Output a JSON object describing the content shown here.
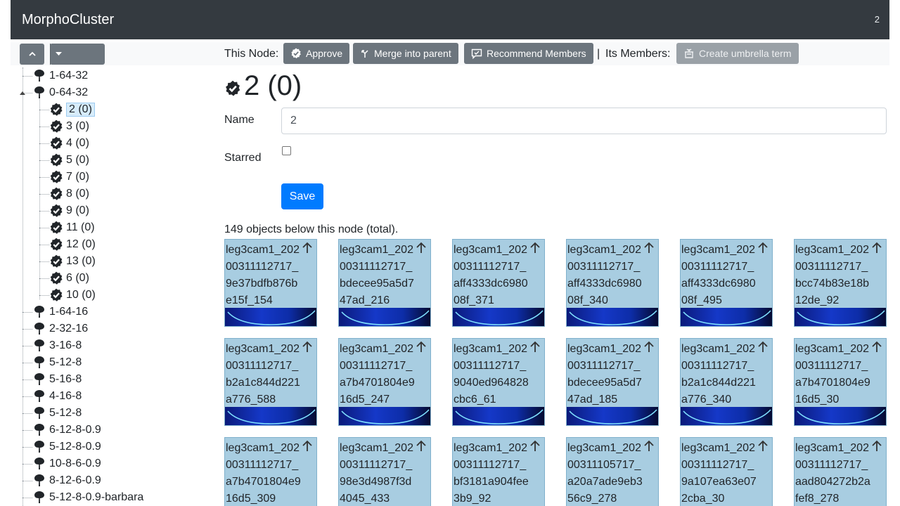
{
  "navbar": {
    "brand": "MorphoCluster",
    "right_text": "2"
  },
  "toolbar": {
    "this_node_label": "This Node:",
    "approve_label": "Approve",
    "merge_label": "Merge into parent",
    "recommend_label": "Recommend Members",
    "separator": "|",
    "its_members_label": "Its Members:",
    "umbrella_label": "Create umbrella term"
  },
  "tree": {
    "items": [
      {
        "label": "1-64-32",
        "icon": "tree-icon",
        "level": 0
      },
      {
        "label": "0-64-32",
        "icon": "tree-icon",
        "level": 0,
        "expanded": true
      },
      {
        "label": "2 (0)",
        "icon": "approved-badge-icon",
        "level": 1,
        "selected": true
      },
      {
        "label": "3 (0)",
        "icon": "approved-badge-icon",
        "level": 1
      },
      {
        "label": "4 (0)",
        "icon": "approved-badge-icon",
        "level": 1
      },
      {
        "label": "5 (0)",
        "icon": "approved-badge-icon",
        "level": 1
      },
      {
        "label": "7 (0)",
        "icon": "approved-badge-icon",
        "level": 1
      },
      {
        "label": "8 (0)",
        "icon": "approved-badge-icon",
        "level": 1
      },
      {
        "label": "9 (0)",
        "icon": "approved-badge-icon",
        "level": 1
      },
      {
        "label": "11 (0)",
        "icon": "approved-badge-icon",
        "level": 1
      },
      {
        "label": "12 (0)",
        "icon": "approved-badge-icon",
        "level": 1
      },
      {
        "label": "13 (0)",
        "icon": "approved-badge-icon",
        "level": 1
      },
      {
        "label": "6 (0)",
        "icon": "approved-badge-icon",
        "level": 1
      },
      {
        "label": "10 (0)",
        "icon": "approved-badge-icon",
        "level": 1
      },
      {
        "label": "1-64-16",
        "icon": "tree-icon",
        "level": 0
      },
      {
        "label": "2-32-16",
        "icon": "tree-icon",
        "level": 0
      },
      {
        "label": "3-16-8",
        "icon": "tree-icon",
        "level": 0
      },
      {
        "label": "5-12-8",
        "icon": "tree-icon",
        "level": 0
      },
      {
        "label": "5-16-8",
        "icon": "tree-icon",
        "level": 0
      },
      {
        "label": "4-16-8",
        "icon": "tree-icon",
        "level": 0
      },
      {
        "label": "5-12-8",
        "icon": "tree-icon",
        "level": 0
      },
      {
        "label": "6-12-8-0.9",
        "icon": "tree-icon",
        "level": 0
      },
      {
        "label": "5-12-8-0.9",
        "icon": "tree-icon",
        "level": 0
      },
      {
        "label": "10-8-6-0.9",
        "icon": "tree-icon",
        "level": 0
      },
      {
        "label": "8-12-6-0.9",
        "icon": "tree-icon",
        "level": 0
      },
      {
        "label": "5-12-8-0.9-barbara",
        "icon": "tree-icon",
        "level": 0
      }
    ]
  },
  "node": {
    "title": "2 (0)",
    "name_label": "Name",
    "name_value": "2",
    "starred_label": "Starred",
    "save_label": "Save",
    "count_text": "149 objects below this node (total)."
  },
  "objects": [
    {
      "name": "leg3cam1_20200311112717_9e37bdfb876be15f_154"
    },
    {
      "name": "leg3cam1_20200311112717_bdecee95a5d747ad_216"
    },
    {
      "name": "leg3cam1_20200311112717_aff4333dc698008f_371"
    },
    {
      "name": "leg3cam1_20200311112717_aff4333dc698008f_340"
    },
    {
      "name": "leg3cam1_20200311112717_aff4333dc698008f_495"
    },
    {
      "name": "leg3cam1_20200311112717_bcc74b83e18b12de_92"
    },
    {
      "name": "leg3cam1_20200311112717_b2a1c844d221a776_588"
    },
    {
      "name": "leg3cam1_20200311112717_a7b4701804e916d5_247"
    },
    {
      "name": "leg3cam1_20200311112717_9040ed964828cbc6_61"
    },
    {
      "name": "leg3cam1_20200311112717_bdecee95a5d747ad_185"
    },
    {
      "name": "leg3cam1_20200311112717_b2a1c844d221a776_340"
    },
    {
      "name": "leg3cam1_20200311112717_a7b4701804e916d5_30"
    },
    {
      "name": "leg3cam1_20200311112717_a7b4701804e916d5_309"
    },
    {
      "name": "leg3cam1_20200311112717_98e3d4987f3d4045_433"
    },
    {
      "name": "leg3cam1_20200311112717_bf3181a904fee3b9_92"
    },
    {
      "name": "leg3cam1_20200311105717_a20a7ade9eb356c9_278"
    },
    {
      "name": "leg3cam1_20200311112717_9a107ea63e072cba_30"
    },
    {
      "name": "leg3cam1_20200311112717_aad804272b2afef8_278"
    }
  ],
  "colors": {
    "navbar": "#343a40",
    "primary": "#007bff",
    "secondary": "#6c757d",
    "card": "#a8cde1"
  }
}
